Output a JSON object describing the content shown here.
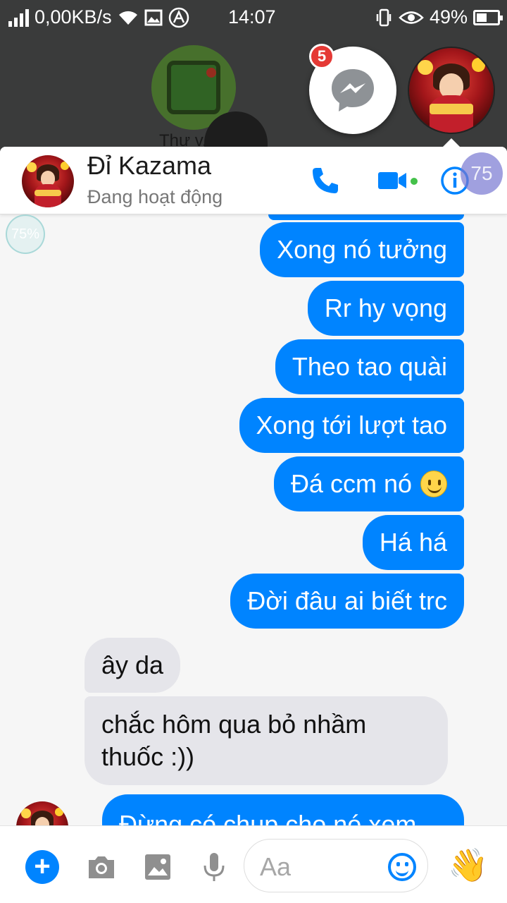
{
  "status_bar": {
    "data_rate": "0,00KB/s",
    "time": "14:07",
    "battery_percent": "49%",
    "battery_level": 0.49,
    "icons": [
      "signal-icon",
      "wifi-icon",
      "image-icon",
      "app-icon",
      "vibrate-icon",
      "eye-icon",
      "battery-icon"
    ]
  },
  "background": {
    "app_label": "Thư v..."
  },
  "chat_heads": {
    "messenger_badge": "5",
    "icons": [
      "messenger-icon"
    ]
  },
  "header": {
    "name": "Đỉ Kazama",
    "status": "Đang hoạt động",
    "icons": [
      "phone-icon",
      "video-icon",
      "info-icon"
    ]
  },
  "overlays": {
    "top": "75",
    "left": "75%"
  },
  "messages": [
    {
      "from": "me",
      "text": "Xong nó tưởng"
    },
    {
      "from": "me",
      "text": "Rr hy vọng"
    },
    {
      "from": "me",
      "text": "Theo tao quài"
    },
    {
      "from": "me",
      "text": "Xong tới lượt tao"
    },
    {
      "from": "me",
      "text": "Đá ccm nó",
      "emoji": "smile-emoji"
    },
    {
      "from": "me",
      "text": "Há há"
    },
    {
      "from": "me",
      "text": "Đời đâu ai biết trc"
    },
    {
      "from": "them",
      "text": "ây da"
    },
    {
      "from": "them",
      "text_line1": "chắc hôm qua bỏ nhầm",
      "text_line2": "thuốc :))"
    },
    {
      "from": "me",
      "text": "Đừng có chụp cho nó xem"
    }
  ],
  "composer": {
    "placeholder": "Aa",
    "icons": [
      "plus-icon",
      "camera-icon",
      "gallery-icon",
      "microphone-icon",
      "emoji-icon",
      "wave-icon"
    ],
    "accent": "#0084ff"
  }
}
